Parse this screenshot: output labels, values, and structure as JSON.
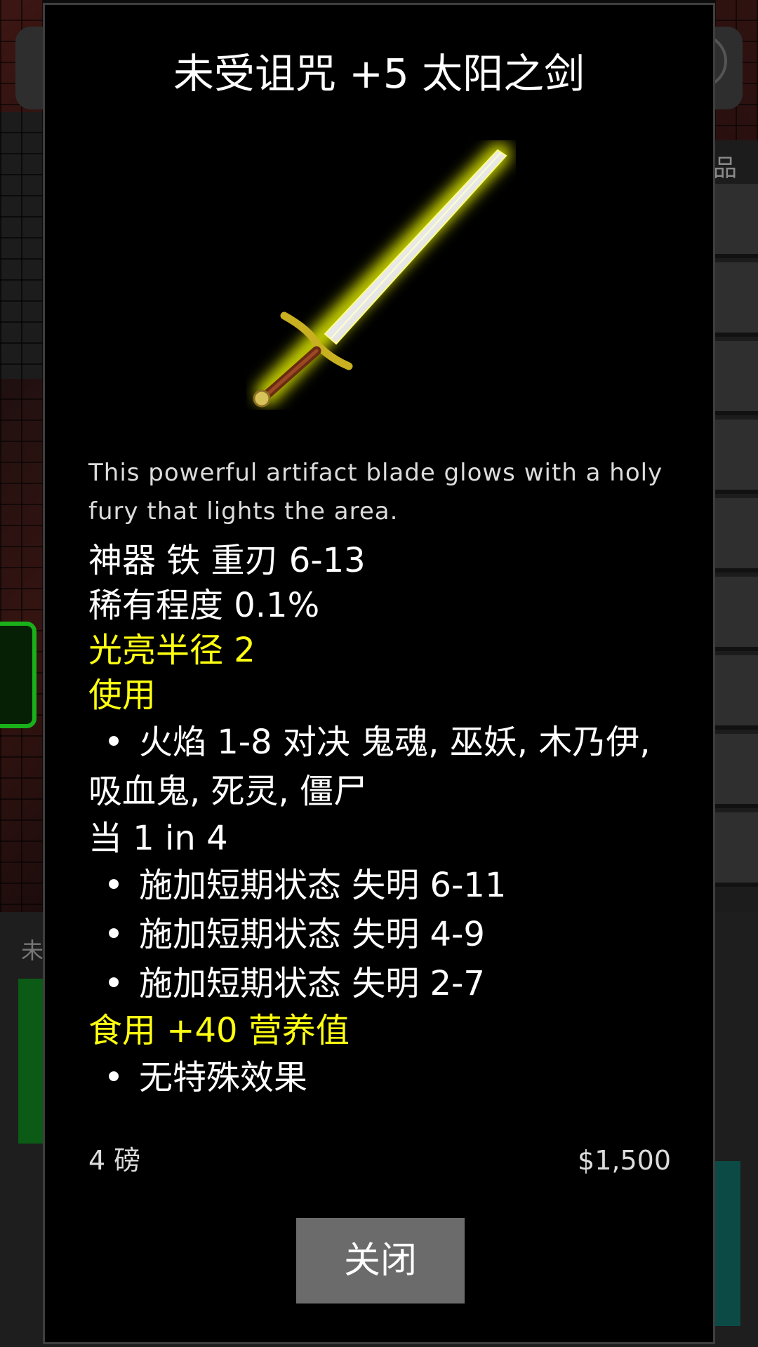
{
  "background": {
    "inventory_label": "品",
    "bottom_label": "未"
  },
  "dialog": {
    "title": "未受诅咒 +5 太阳之剑",
    "item_icon": "sun-sword-icon",
    "description": "This powerful artifact blade glows with a holy fury that lights the area.",
    "stats": [
      "神器 铁 重刃 6-13",
      "稀有程度 0.1%"
    ],
    "light_radius": "光亮半径 2",
    "use_heading": "使用",
    "use_effects": [
      "火焰 1-8 对决 鬼魂, 巫妖, 木乃伊, 吸血鬼, 死灵, 僵尸"
    ],
    "chance_line": "当 1 in 4",
    "chance_effects": [
      "施加短期状态 失明 6-11",
      "施加短期状态 失明 4-9",
      "施加短期状态 失明 2-7"
    ],
    "eat_heading": "食用 +40 营养值",
    "eat_effects": [
      "无特殊效果"
    ],
    "bullet": "•",
    "weight": "4 磅",
    "price": "$1,500",
    "close_label": "关闭"
  },
  "colors": {
    "highlight": "#ffff11",
    "dialog_bg": "#000000",
    "button_bg": "#6b6b6b"
  }
}
